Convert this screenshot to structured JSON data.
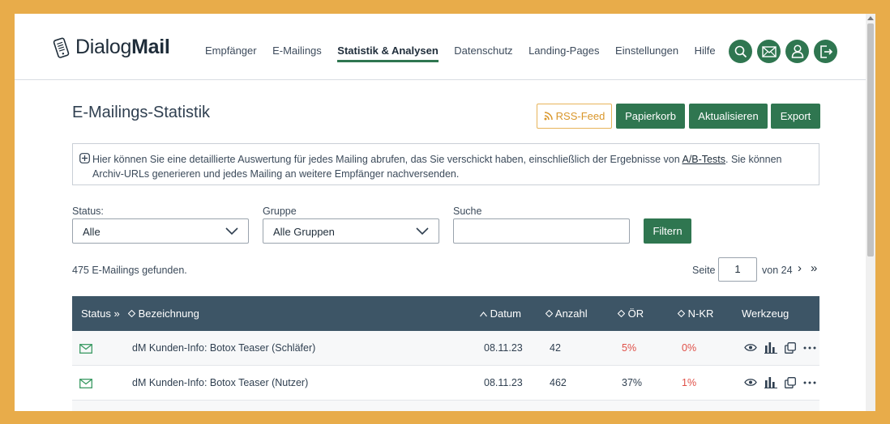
{
  "app": {
    "logo_plain": "Dialog",
    "logo_bold": "Mail"
  },
  "nav": [
    {
      "label": "Empfänger",
      "active": false
    },
    {
      "label": "E-Mailings",
      "active": false
    },
    {
      "label": "Statistik & Analysen",
      "active": true
    },
    {
      "label": "Datenschutz",
      "active": false
    },
    {
      "label": "Landing-Pages",
      "active": false
    },
    {
      "label": "Einstellungen",
      "active": false
    },
    {
      "label": "Hilfe",
      "active": false
    }
  ],
  "header_icons": [
    "search-icon",
    "mail-icon",
    "user-icon",
    "logout-icon"
  ],
  "page": {
    "title": "E-Mailings-Statistik"
  },
  "actions": {
    "rss": "RSS-Feed",
    "trash": "Papierkorb",
    "refresh": "Aktualisieren",
    "export": "Export"
  },
  "info": {
    "text_before": "Hier können Sie eine detaillierte Auswertung für jedes Mailing abrufen, das Sie verschickt haben, einschließlich der Ergebnisse von ",
    "link": "A/B-Tests",
    "text_after": ". Sie können Archiv-URLs generieren und jedes Mailing an weitere Empfänger nachversenden."
  },
  "filters": {
    "status_label": "Status:",
    "status_value": "Alle",
    "group_label": "Gruppe",
    "group_value": "Alle Gruppen",
    "search_label": "Suche",
    "search_value": "",
    "filter_button": "Filtern"
  },
  "results": {
    "found": "475 E-Mailings gefunden.",
    "page_label": "Seite",
    "page_current": "1",
    "page_of": "von 24",
    "next": "›",
    "last": "»"
  },
  "table": {
    "headers": {
      "status": "Status",
      "status_toggle": "»",
      "name": "Bezeichnung",
      "date": "Datum",
      "count": "Anzahl",
      "open_rate": "ÖR",
      "nkr": "N-KR",
      "tools": "Werkzeug"
    },
    "rows": [
      {
        "name": "dM Kunden-Info: Botox Teaser (Schläfer)",
        "date": "08.11.23",
        "count": "42",
        "open_rate": "5%",
        "nkr": "0%",
        "open_alert": true,
        "nkr_alert": true
      },
      {
        "name": "dM Kunden-Info: Botox Teaser (Nutzer)",
        "date": "08.11.23",
        "count": "462",
        "open_rate": "37%",
        "nkr": "1%",
        "open_alert": false,
        "nkr_alert": true
      }
    ]
  },
  "colors": {
    "brand_green": "#2f7650",
    "table_header": "#3d5566",
    "alert_red": "#e05048",
    "rss_orange": "#d9962a"
  }
}
